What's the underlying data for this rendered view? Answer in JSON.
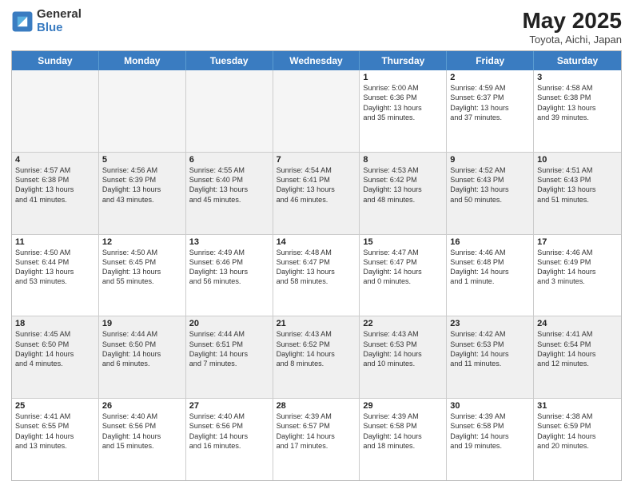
{
  "logo": {
    "line1": "General",
    "line2": "Blue"
  },
  "title": "May 2025",
  "subtitle": "Toyota, Aichi, Japan",
  "days": [
    "Sunday",
    "Monday",
    "Tuesday",
    "Wednesday",
    "Thursday",
    "Friday",
    "Saturday"
  ],
  "rows": [
    [
      {
        "day": "",
        "info": "",
        "empty": true
      },
      {
        "day": "",
        "info": "",
        "empty": true
      },
      {
        "day": "",
        "info": "",
        "empty": true
      },
      {
        "day": "",
        "info": "",
        "empty": true
      },
      {
        "day": "1",
        "info": "Sunrise: 5:00 AM\nSunset: 6:36 PM\nDaylight: 13 hours\nand 35 minutes."
      },
      {
        "day": "2",
        "info": "Sunrise: 4:59 AM\nSunset: 6:37 PM\nDaylight: 13 hours\nand 37 minutes."
      },
      {
        "day": "3",
        "info": "Sunrise: 4:58 AM\nSunset: 6:38 PM\nDaylight: 13 hours\nand 39 minutes."
      }
    ],
    [
      {
        "day": "4",
        "info": "Sunrise: 4:57 AM\nSunset: 6:38 PM\nDaylight: 13 hours\nand 41 minutes."
      },
      {
        "day": "5",
        "info": "Sunrise: 4:56 AM\nSunset: 6:39 PM\nDaylight: 13 hours\nand 43 minutes."
      },
      {
        "day": "6",
        "info": "Sunrise: 4:55 AM\nSunset: 6:40 PM\nDaylight: 13 hours\nand 45 minutes."
      },
      {
        "day": "7",
        "info": "Sunrise: 4:54 AM\nSunset: 6:41 PM\nDaylight: 13 hours\nand 46 minutes."
      },
      {
        "day": "8",
        "info": "Sunrise: 4:53 AM\nSunset: 6:42 PM\nDaylight: 13 hours\nand 48 minutes."
      },
      {
        "day": "9",
        "info": "Sunrise: 4:52 AM\nSunset: 6:43 PM\nDaylight: 13 hours\nand 50 minutes."
      },
      {
        "day": "10",
        "info": "Sunrise: 4:51 AM\nSunset: 6:43 PM\nDaylight: 13 hours\nand 51 minutes."
      }
    ],
    [
      {
        "day": "11",
        "info": "Sunrise: 4:50 AM\nSunset: 6:44 PM\nDaylight: 13 hours\nand 53 minutes."
      },
      {
        "day": "12",
        "info": "Sunrise: 4:50 AM\nSunset: 6:45 PM\nDaylight: 13 hours\nand 55 minutes."
      },
      {
        "day": "13",
        "info": "Sunrise: 4:49 AM\nSunset: 6:46 PM\nDaylight: 13 hours\nand 56 minutes."
      },
      {
        "day": "14",
        "info": "Sunrise: 4:48 AM\nSunset: 6:47 PM\nDaylight: 13 hours\nand 58 minutes."
      },
      {
        "day": "15",
        "info": "Sunrise: 4:47 AM\nSunset: 6:47 PM\nDaylight: 14 hours\nand 0 minutes."
      },
      {
        "day": "16",
        "info": "Sunrise: 4:46 AM\nSunset: 6:48 PM\nDaylight: 14 hours\nand 1 minute."
      },
      {
        "day": "17",
        "info": "Sunrise: 4:46 AM\nSunset: 6:49 PM\nDaylight: 14 hours\nand 3 minutes."
      }
    ],
    [
      {
        "day": "18",
        "info": "Sunrise: 4:45 AM\nSunset: 6:50 PM\nDaylight: 14 hours\nand 4 minutes."
      },
      {
        "day": "19",
        "info": "Sunrise: 4:44 AM\nSunset: 6:50 PM\nDaylight: 14 hours\nand 6 minutes."
      },
      {
        "day": "20",
        "info": "Sunrise: 4:44 AM\nSunset: 6:51 PM\nDaylight: 14 hours\nand 7 minutes."
      },
      {
        "day": "21",
        "info": "Sunrise: 4:43 AM\nSunset: 6:52 PM\nDaylight: 14 hours\nand 8 minutes."
      },
      {
        "day": "22",
        "info": "Sunrise: 4:43 AM\nSunset: 6:53 PM\nDaylight: 14 hours\nand 10 minutes."
      },
      {
        "day": "23",
        "info": "Sunrise: 4:42 AM\nSunset: 6:53 PM\nDaylight: 14 hours\nand 11 minutes."
      },
      {
        "day": "24",
        "info": "Sunrise: 4:41 AM\nSunset: 6:54 PM\nDaylight: 14 hours\nand 12 minutes."
      }
    ],
    [
      {
        "day": "25",
        "info": "Sunrise: 4:41 AM\nSunset: 6:55 PM\nDaylight: 14 hours\nand 13 minutes."
      },
      {
        "day": "26",
        "info": "Sunrise: 4:40 AM\nSunset: 6:56 PM\nDaylight: 14 hours\nand 15 minutes."
      },
      {
        "day": "27",
        "info": "Sunrise: 4:40 AM\nSunset: 6:56 PM\nDaylight: 14 hours\nand 16 minutes."
      },
      {
        "day": "28",
        "info": "Sunrise: 4:39 AM\nSunset: 6:57 PM\nDaylight: 14 hours\nand 17 minutes."
      },
      {
        "day": "29",
        "info": "Sunrise: 4:39 AM\nSunset: 6:58 PM\nDaylight: 14 hours\nand 18 minutes."
      },
      {
        "day": "30",
        "info": "Sunrise: 4:39 AM\nSunset: 6:58 PM\nDaylight: 14 hours\nand 19 minutes."
      },
      {
        "day": "31",
        "info": "Sunrise: 4:38 AM\nSunset: 6:59 PM\nDaylight: 14 hours\nand 20 minutes."
      }
    ]
  ]
}
